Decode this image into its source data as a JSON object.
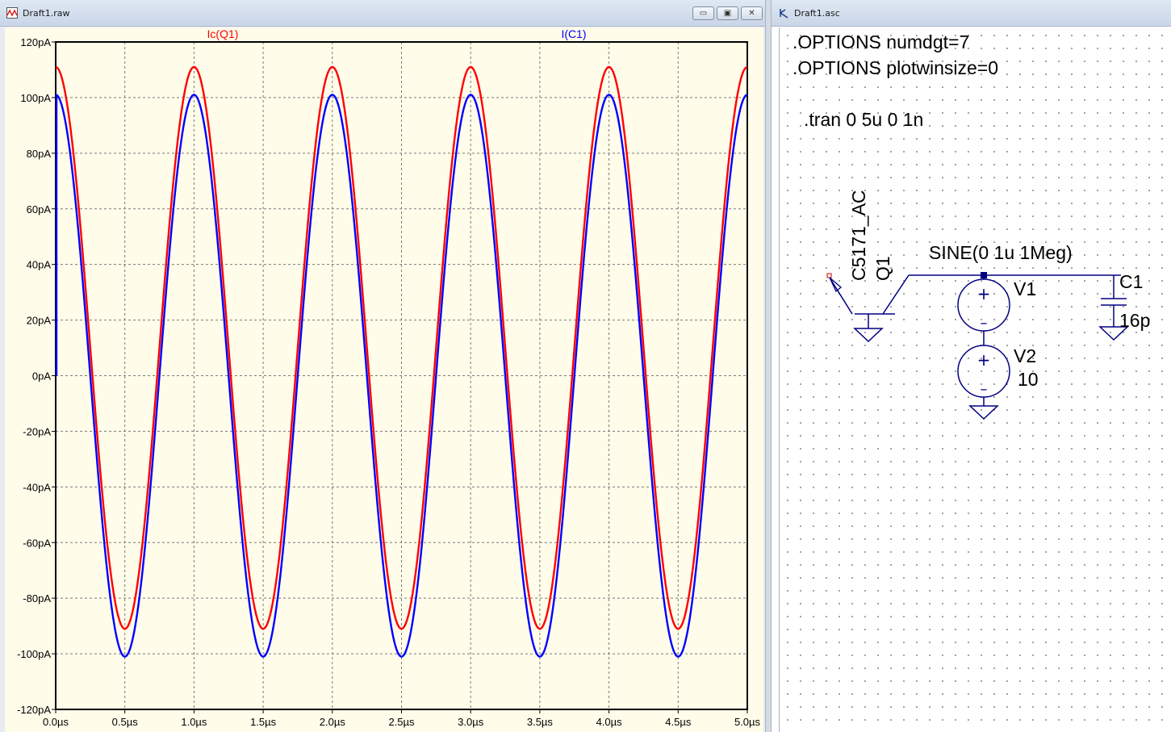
{
  "waveform_window": {
    "title": "Draft1.raw",
    "buttons": {
      "minimize": "▭",
      "restore": "▣",
      "close": "✕"
    }
  },
  "schematic_window": {
    "title": "Draft1.asc",
    "directives": [
      ".OPTIONS numdgt=7",
      ".OPTIONS plotwinsize=0",
      ".tran 0 5u 0 1n"
    ],
    "components": {
      "q1": {
        "ref": "Q1",
        "model": "C5171_AC"
      },
      "v1": {
        "ref": "V1",
        "value": "SINE(0 1u 1Meg)"
      },
      "v2": {
        "ref": "V2",
        "value": "10"
      },
      "c1": {
        "ref": "C1",
        "value": "16p"
      }
    },
    "colors": {
      "wire": "#000080",
      "symbol": "#000080",
      "junction": "#000080"
    }
  },
  "chart_data": {
    "type": "line",
    "x_unit": "µs",
    "y_unit": "pA",
    "xlim": [
      0,
      5
    ],
    "ylim": [
      -120,
      120
    ],
    "x_ticks": [
      "0.0µs",
      "0.5µs",
      "1.0µs",
      "1.5µs",
      "2.0µs",
      "2.5µs",
      "3.0µs",
      "3.5µs",
      "4.0µs",
      "4.5µs",
      "5.0µs"
    ],
    "y_ticks": [
      "120pA",
      "100pA",
      "80pA",
      "60pA",
      "40pA",
      "20pA",
      "0pA",
      "-20pA",
      "-40pA",
      "-60pA",
      "-80pA",
      "-100pA",
      "-120pA"
    ],
    "grid": true,
    "background": "#fffcea",
    "series": [
      {
        "name": "Ic(Q1)",
        "color": "#ff0000",
        "offset": 10,
        "amplitude": 101,
        "frequency_mhz": 1
      },
      {
        "name": "I(C1)",
        "color": "#0000ff",
        "offset": 0,
        "amplitude": 101,
        "frequency_mhz": 1
      }
    ]
  }
}
